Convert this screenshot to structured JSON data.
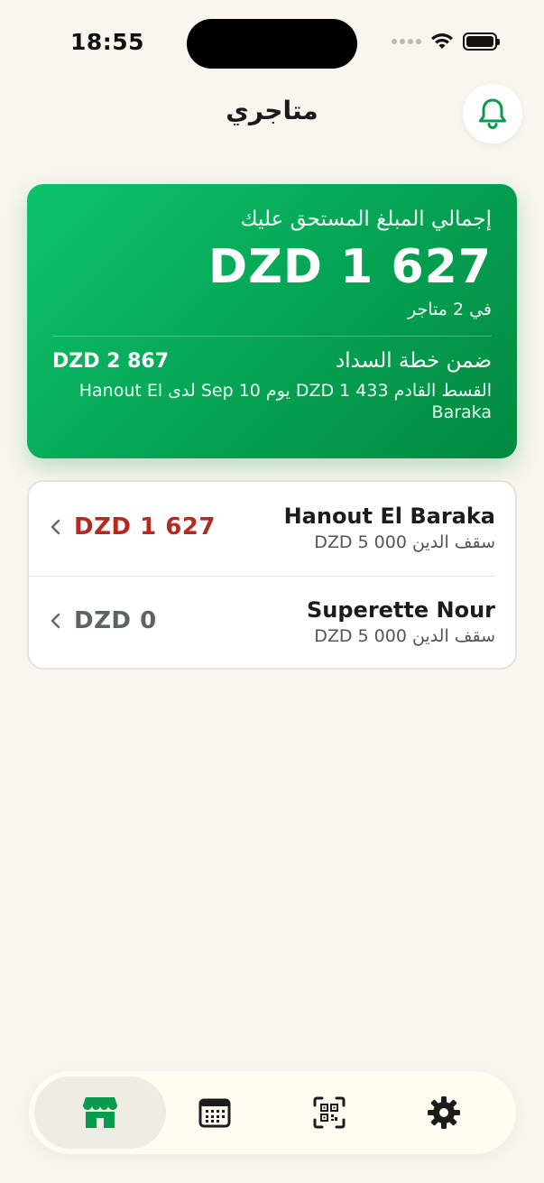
{
  "status_bar": {
    "time": "18:55"
  },
  "header": {
    "title": "متاجري"
  },
  "summary": {
    "label": "إجمالي المبلغ المستحق عليك",
    "total": "DZD 1 627",
    "stores_count_text": "في 2 متاجر",
    "plan_label": "ضمن خطة السداد",
    "plan_amount": "DZD 2 867",
    "next_installment": "القسط القادم DZD 1 433 يوم Sep 10 لدى Hanout El Baraka"
  },
  "stores": [
    {
      "name": "Hanout El Baraka",
      "limit": "سقف الدين DZD 5 000",
      "balance": "DZD 1 627"
    },
    {
      "name": "Superette Nour",
      "limit": "سقف الدين DZD 5 000",
      "balance": "DZD 0"
    }
  ],
  "tabs": [
    {
      "icon": "store-icon",
      "active": true
    },
    {
      "icon": "calendar-icon",
      "active": false
    },
    {
      "icon": "qr-scan-icon",
      "active": false
    },
    {
      "icon": "gear-icon",
      "active": false
    }
  ],
  "colors": {
    "accent": "#07a854",
    "due": "#b22a22",
    "background": "#f8f6ef"
  }
}
